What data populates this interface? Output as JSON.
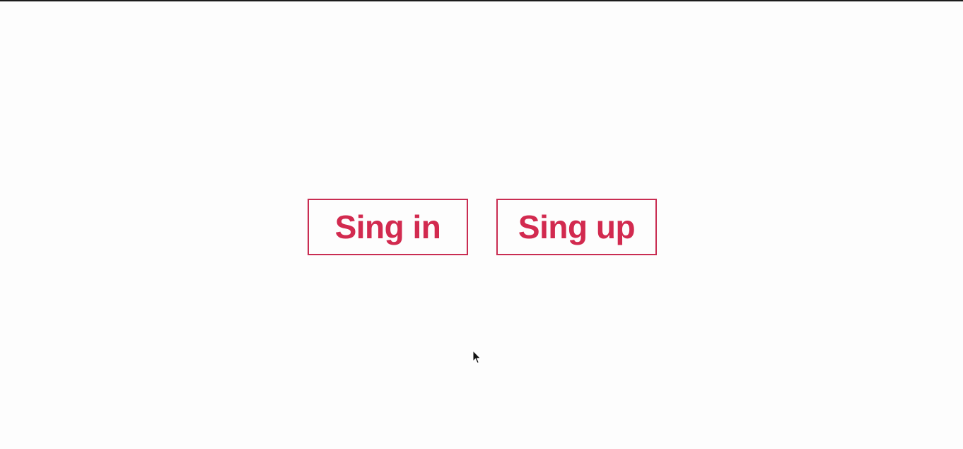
{
  "buttons": {
    "signin_label": "Sing in",
    "signup_label": "Sing up"
  },
  "colors": {
    "accent": "#d22a4f",
    "border": "#c92d52",
    "background": "#fdfdfd"
  },
  "icons": {
    "cursor": "mouse-pointer-icon"
  }
}
